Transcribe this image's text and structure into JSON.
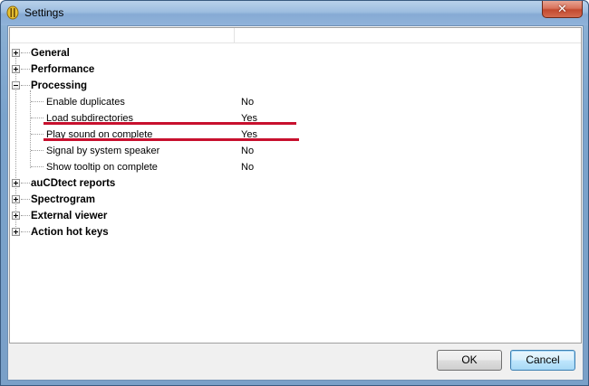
{
  "window": {
    "title": "Settings",
    "close_glyph": "✕"
  },
  "tree": {
    "groups_top": [
      {
        "label": "General",
        "expander": "+"
      },
      {
        "label": "Performance",
        "expander": "+"
      }
    ],
    "processing": {
      "label": "Processing",
      "expander": "−",
      "children": [
        {
          "label": "Enable duplicates",
          "value": "No"
        },
        {
          "label": "Load subdirectories",
          "value": "Yes"
        },
        {
          "label": "Play sound on complete",
          "value": "Yes"
        },
        {
          "label": "Signal by system speaker",
          "value": "No"
        },
        {
          "label": "Show tooltip on complete",
          "value": "No"
        }
      ]
    },
    "groups_bottom": [
      {
        "label": "auCDtect reports",
        "expander": "+"
      },
      {
        "label": "Spectrogram",
        "expander": "+"
      },
      {
        "label": "External viewer",
        "expander": "+"
      },
      {
        "label": "Action hot keys",
        "expander": "+"
      }
    ]
  },
  "buttons": {
    "ok_label": "OK",
    "cancel_label": "Cancel"
  },
  "annotations": {
    "underline_color": "#c8102e"
  }
}
